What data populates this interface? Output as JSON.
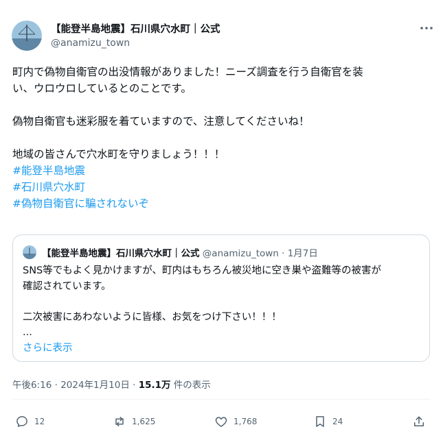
{
  "author": {
    "name": "【能登半島地震】石川県穴水町｜公式",
    "handle": "@anamizu_town"
  },
  "tweet": {
    "lines": [
      "町内で偽物自衛官の出没情報がありました！ニーズ調査を行う自衛官を装",
      "い、ウロウロしているとのことです。",
      "偽物自衛官も迷彩服を着ていますので、注意してくださいね！",
      "地域の皆さんで穴水町を守りましょう！！！"
    ],
    "hashtags": [
      "#能登半島地震",
      "#石川県穴水町",
      "#偽物自衛官に騙されないぞ"
    ]
  },
  "quote": {
    "name": "【能登半島地震】石川県穴水町｜公式",
    "meta": "@anamizu_town · 1月7日",
    "lines": [
      "SNS等でもよく見かけますが、町内はもちろん被災地に空き巣や盗難等の被害が",
      "確認されています。",
      "二次被害にあわないように皆様、お気をつけ下さい！！！",
      "..."
    ],
    "show_more": "さらに表示"
  },
  "timestamp": {
    "time_date": "午後6:16 · 2024年1月10日 · ",
    "views": "15.1万",
    "views_suffix": " 件の表示"
  },
  "actions": {
    "replies": "12",
    "retweets": "1,625",
    "likes": "1,768",
    "bookmarks": "24"
  },
  "colors": {
    "link": "#1d9bf0",
    "secondary_text": "#536471",
    "border": "#cfd9de"
  }
}
